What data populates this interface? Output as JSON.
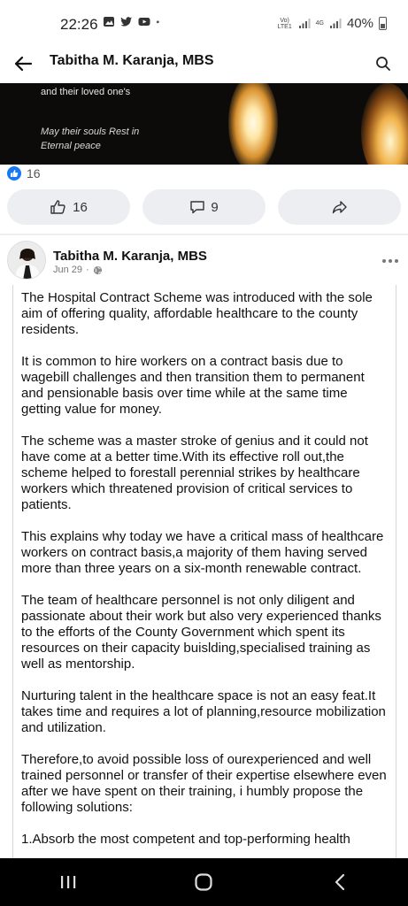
{
  "status": {
    "time": "22:26",
    "network_label": "Vo) LTE1",
    "network_label2": "4G",
    "battery": "40%"
  },
  "header": {
    "title": "Tabitha M. Karanja, MBS"
  },
  "photo": {
    "line1": "and their loved one's",
    "line2": "May their souls Rest in Eternal peace"
  },
  "reactions": {
    "count": "16"
  },
  "actions": {
    "like_count": "16",
    "comment_count": "9"
  },
  "post": {
    "author": "Tabitha M. Karanja, MBS",
    "date": "Jun 29",
    "separator": "·",
    "paragraphs": [
      "The Hospital Contract Scheme was introduced with the sole aim of offering quality, affordable healthcare to the county residents.",
      "It is common to hire workers on a contract basis due to wagebill challenges and then transition them to permanent and pensionable basis over time while at the same time getting value for money.",
      "The scheme was a master stroke of genius and it could not have come at a better time.With its effective roll out,the scheme helped to forestall perennial strikes by healthcare workers which threatened provision of critical services to patients.",
      "This explains why today we have a critical mass of healthcare workers on contract basis,a majority of them having served more than three years on a six-month renewable contract.",
      "The team of healthcare personnel is not only diligent and passionate about their work but also very experienced thanks to the efforts of the County Government which spent its resources on their capacity buislding,specialised training as well as mentorship.",
      "Nurturing talent in the healthcare space is not an easy feat.It takes time and requires a lot of planning,resource mobilization and utilization.",
      "Therefore,to avoid possible loss of  ourexperienced and well trained personnel or transfer of their expertise elsewhere even after we have spent on their training, i humbly propose the following solutions:",
      "1.Absorb the most competent and top-performing health"
    ]
  },
  "colors": {
    "facebook_blue": "#1877f2",
    "button_bg": "#eceef1"
  }
}
